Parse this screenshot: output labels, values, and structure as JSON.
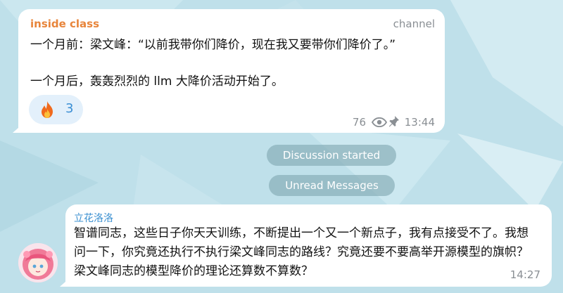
{
  "message1": {
    "sender": "inside class",
    "tag": "channel",
    "line1": "一个月前：梁文峰：“以前我带你们降价，现在我又要带你们降价了。”",
    "line2": "一个月后，轰轰烈烈的 llm 大降价活动开始了。",
    "reaction": {
      "icon": "fire-icon",
      "count": "3"
    },
    "views": "76",
    "time": "13:44"
  },
  "service": {
    "discussion": "Discussion started",
    "unread": "Unread Messages"
  },
  "message2": {
    "sender": "立花洛洛",
    "body": "智谱同志，这些日子你天天训练，不断提出一个又一个新点子，我有点接受不了。我想问一下，你究竟还执行不执行梁文峰同志的路线？究竟还要不要高举开源模型的旗帜？梁文峰同志的模型降价的理论还算数不算数？",
    "time": "14:27"
  },
  "colors": {
    "background": "#bfe0ea",
    "channel_name": "#e8853b",
    "sender_name": "#3a8fd0",
    "reaction_bg": "#e3f0fb",
    "service_pill": "#80a8b2"
  }
}
